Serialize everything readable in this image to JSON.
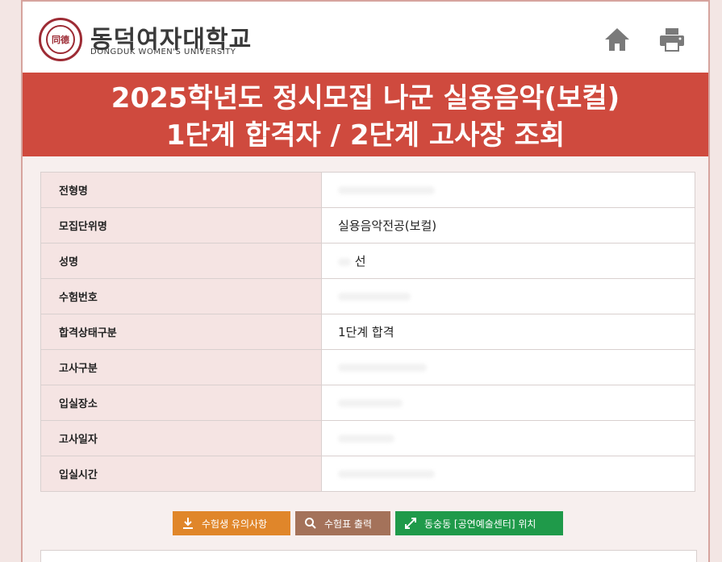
{
  "header": {
    "logo_ko": "동덕여자대학교",
    "logo_en": "DONGDUK WOMEN'S UNIVERSITY",
    "home_icon": "home-icon",
    "print_icon": "print-icon"
  },
  "banner": {
    "line1": "2025학년도 정시모집 나군 실용음악(보컬)",
    "line2": "1단계 합격자 / 2단계 고사장 조회"
  },
  "rows": [
    {
      "label": "전형명",
      "value": ""
    },
    {
      "label": "모집단위명",
      "value": "실용음악전공(보컬)"
    },
    {
      "label": "성명",
      "value": "선"
    },
    {
      "label": "수험번호",
      "value": ""
    },
    {
      "label": "합격상태구분",
      "value": "1단계 합격"
    },
    {
      "label": "고사구분",
      "value": ""
    },
    {
      "label": "입실장소",
      "value": ""
    },
    {
      "label": "고사일자",
      "value": ""
    },
    {
      "label": "입실시간",
      "value": ""
    }
  ],
  "buttons": {
    "notice": "수험생 유의사항",
    "ticket": "수험표 출력",
    "location": "동숭동 [공연예술센터] 위치"
  },
  "colors": {
    "banner": "#cf4a3e",
    "notice_btn": "#e0862a",
    "ticket_btn": "#a4725a",
    "location_btn": "#1f9a4a"
  }
}
